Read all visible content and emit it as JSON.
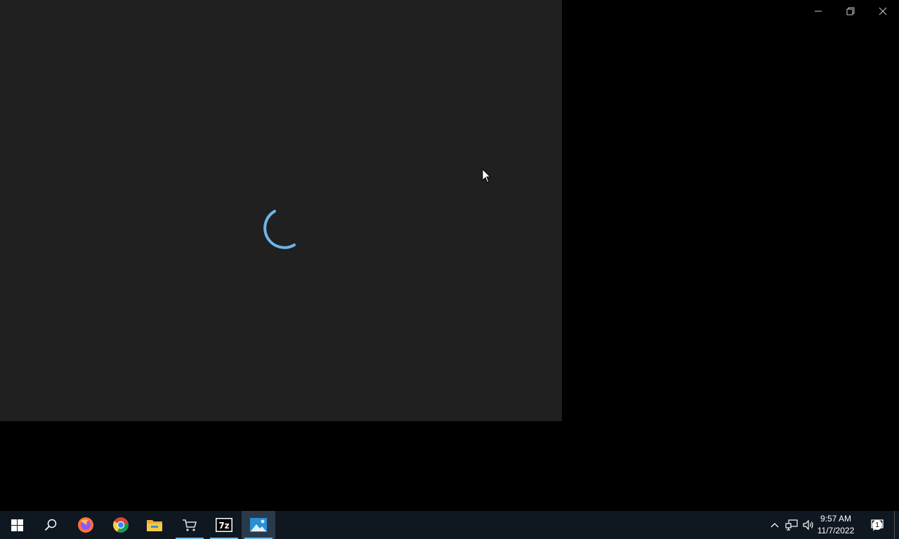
{
  "window": {
    "state": "loading",
    "controls": {
      "minimize_icon": "minimize-icon",
      "restore_icon": "restore-icon",
      "close_icon": "close-icon"
    }
  },
  "taskbar": {
    "apps": [
      {
        "name": "Start",
        "icon": "windows-logo-icon"
      },
      {
        "name": "Search",
        "icon": "search-icon"
      },
      {
        "name": "Firefox",
        "icon": "firefox-icon"
      },
      {
        "name": "Chrome",
        "icon": "chrome-icon"
      },
      {
        "name": "File Explorer",
        "icon": "folder-icon"
      },
      {
        "name": "Store",
        "icon": "cart-icon",
        "running": true
      },
      {
        "name": "7-Zip",
        "icon": "7zip-icon",
        "label": "7z",
        "running": true
      },
      {
        "name": "Photos",
        "icon": "photos-icon",
        "running": true,
        "active": true
      }
    ],
    "clock": {
      "time": "9:57 AM",
      "date": "11/7/2022"
    },
    "notification_count": "1"
  },
  "colors": {
    "desktop": "#000000",
    "window_bg": "#202020",
    "spinner": "#6fb5e8",
    "taskbar_bg": "#0f1720",
    "accent": "#76b9ed"
  }
}
